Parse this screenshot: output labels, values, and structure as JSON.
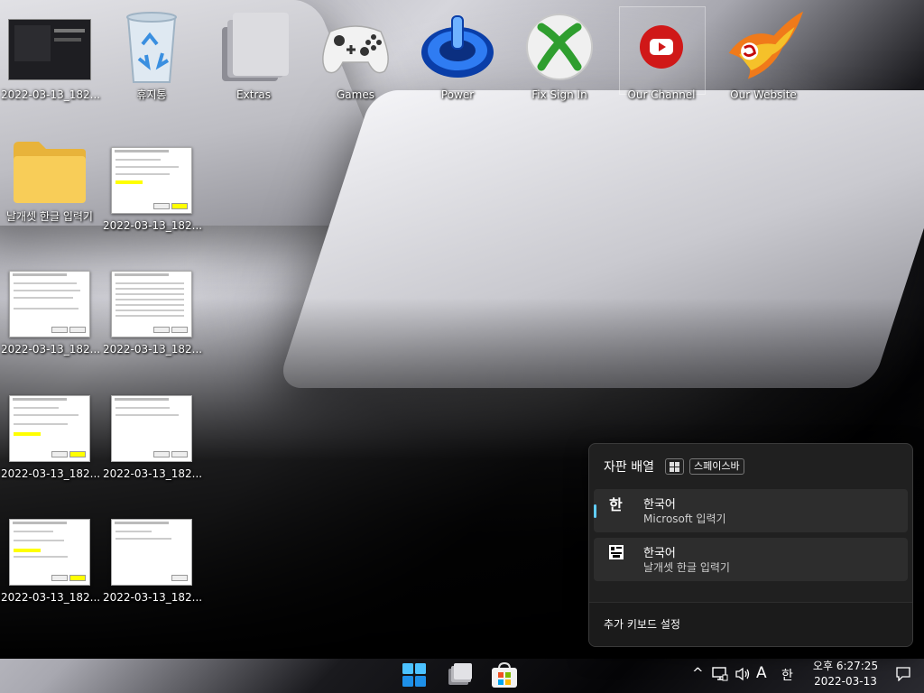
{
  "desktop": {
    "top_row": [
      {
        "label": "2022-03-13_182..."
      },
      {
        "label": "휴지통"
      },
      {
        "label": "Extras"
      },
      {
        "label": "Games"
      },
      {
        "label": "Power"
      },
      {
        "label": "Fix Sign In"
      },
      {
        "label": "Our Channel"
      },
      {
        "label": "Our Website"
      }
    ],
    "col_icons": [
      {
        "label": "날개셋 한글 입력기"
      },
      {
        "label": "2022-03-13_182..."
      },
      {
        "label": "2022-03-13_182..."
      },
      {
        "label": "2022-03-13_182..."
      },
      {
        "label": "2022-03-13_182..."
      },
      {
        "label": "2022-03-13_182..."
      },
      {
        "label": "2022-03-13_182..."
      },
      {
        "label": "2022-03-13_182..."
      }
    ]
  },
  "flyout": {
    "title": "자판 배열",
    "shortcut": "스페이스바",
    "items": [
      {
        "glyph": "한",
        "name": "한국어",
        "ime": "Microsoft 입력기",
        "selected": true
      },
      {
        "glyph": "",
        "name": "한국어",
        "ime": "날개셋 한글 입력기",
        "selected": false
      }
    ],
    "footer": "추가 키보드 설정"
  },
  "taskbar": {
    "apps": [
      {
        "icon": "windows-start-icon"
      },
      {
        "icon": "file-explorer-icon"
      },
      {
        "icon": "microsoft-store-icon"
      }
    ],
    "tray": {
      "chevron": "^",
      "ime_mode": "A",
      "ime_lang": "한"
    },
    "clock": {
      "time": "오후 6:27:25",
      "date": "2022-03-13"
    }
  },
  "colors": {
    "accent": "#60cdff",
    "flyout_bg": "#202020",
    "item_bg": "#2d2d2d"
  }
}
